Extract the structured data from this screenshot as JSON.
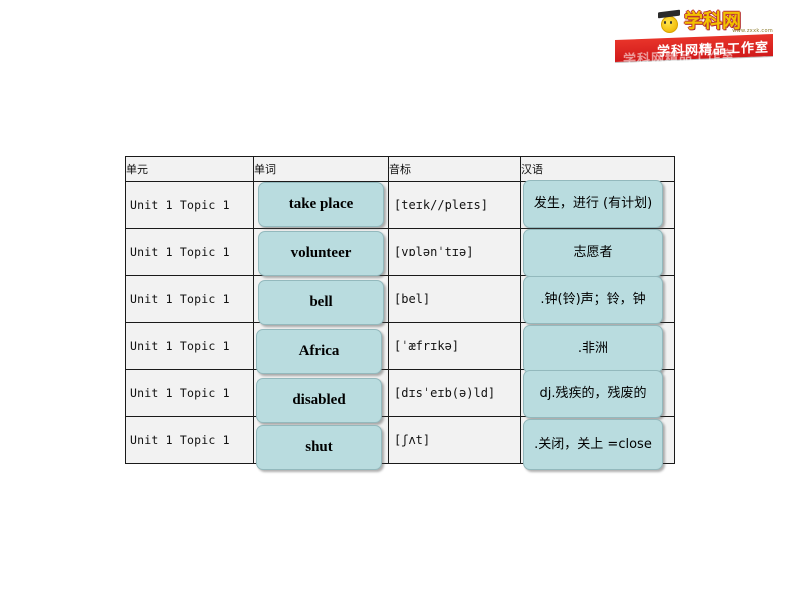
{
  "logo": {
    "brand_cn": "学科网",
    "brand_url": "www.zxxk.com",
    "banner_text": "学科网精品工作室",
    "banner_color": "#d0191a",
    "brand_text_color": "#f2c200"
  },
  "table": {
    "headers": [
      "单元",
      "单词",
      "音标",
      "汉语"
    ],
    "box_fill": "#b9dcdf",
    "box_border": "#93b9bd",
    "rows": [
      {
        "unit": "Unit 1 Topic 1",
        "word": "take place",
        "phonetic": "[teɪk//pleɪs]",
        "chinese": "发生，进行 (有计划)"
      },
      {
        "unit": "Unit 1 Topic 1",
        "word": "volunteer",
        "phonetic": "[vɒlənˈtɪə]",
        "chinese": "志愿者"
      },
      {
        "unit": "Unit 1 Topic 1",
        "word": "bell",
        "phonetic": "[bel]",
        "chinese": ".钟(铃)声；铃，钟"
      },
      {
        "unit": "Unit 1 Topic 1",
        "word": "Africa",
        "phonetic": "[ˈæfrɪkə]",
        "chinese": ".非洲"
      },
      {
        "unit": "Unit 1 Topic 1",
        "word": "disabled",
        "phonetic": "[dɪsˈeɪb(ə)ld]",
        "chinese": "dj.残疾的，残废的"
      },
      {
        "unit": "Unit 1 Topic 1",
        "word": "shut",
        "phonetic": "[ʃʌt]",
        "chinese": ".关闭，关上 =close"
      }
    ]
  }
}
